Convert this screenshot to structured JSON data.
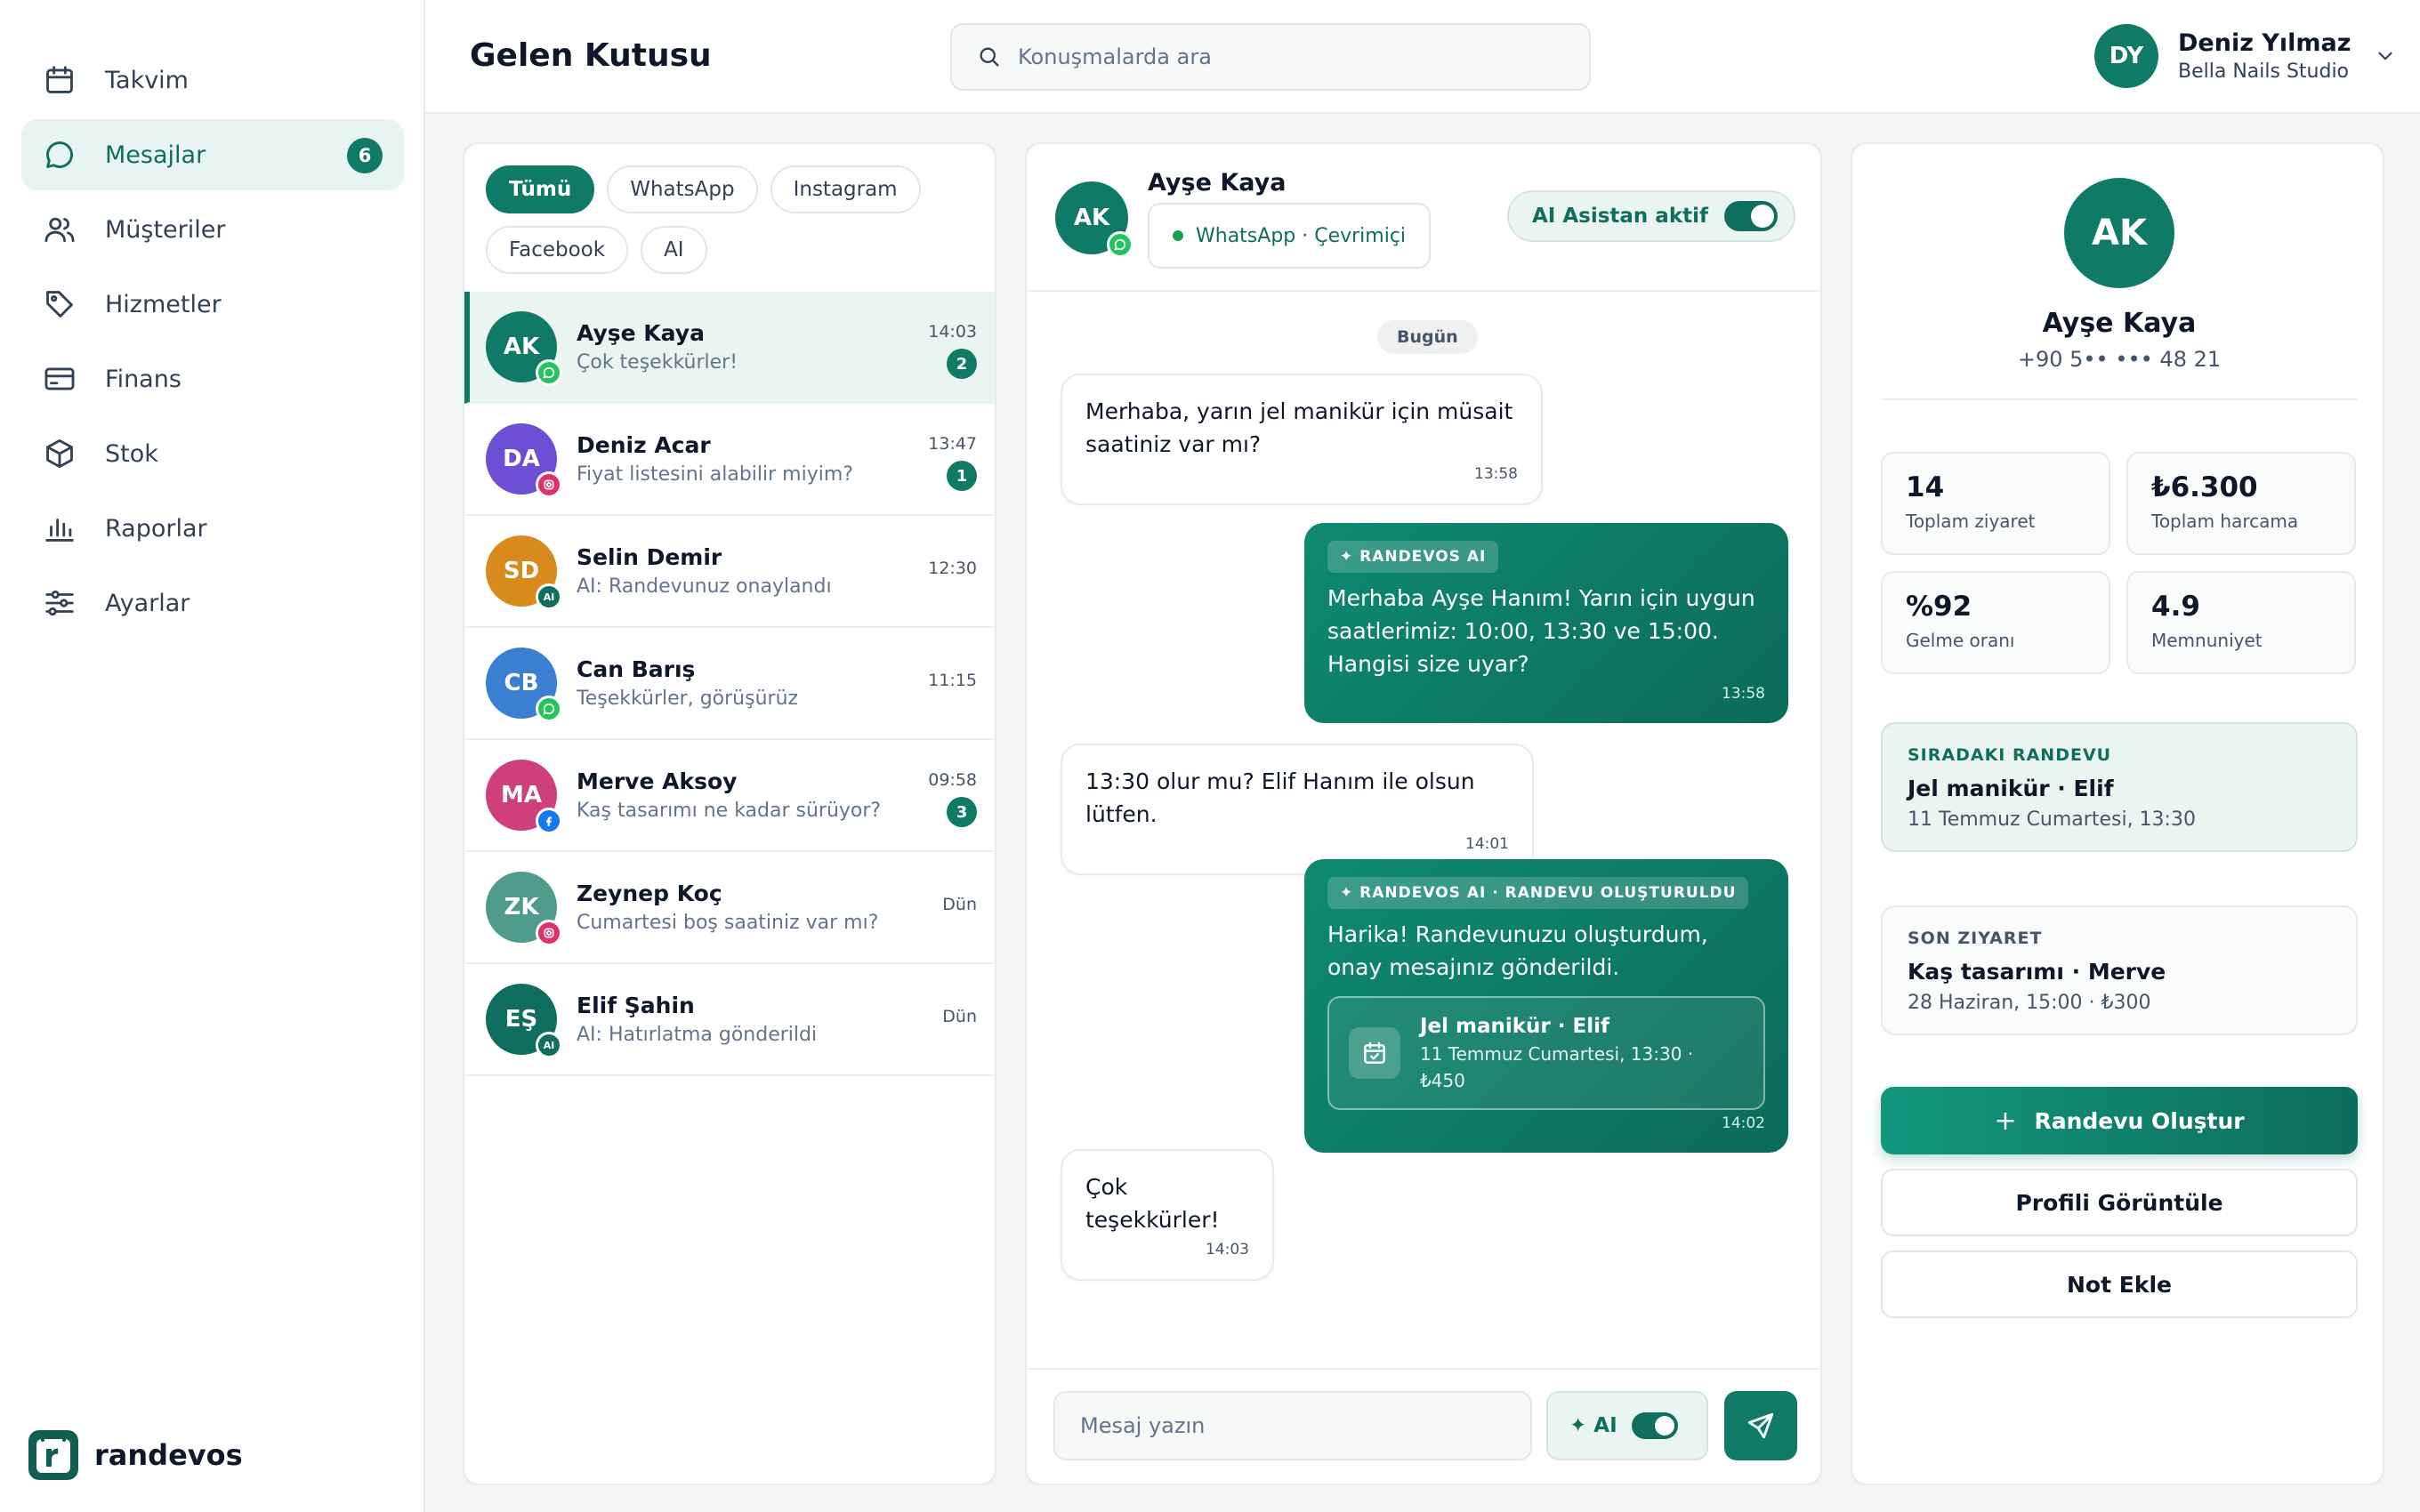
{
  "sidebar": {
    "items": [
      {
        "label": "Takvim",
        "icon": "calendar-icon"
      },
      {
        "label": "Mesajlar",
        "icon": "message-icon",
        "badge": "6",
        "active": true
      },
      {
        "label": "Müşteriler",
        "icon": "users-icon"
      },
      {
        "label": "Hizmetler",
        "icon": "tag-icon"
      },
      {
        "label": "Finans",
        "icon": "credit-card-icon"
      },
      {
        "label": "Stok",
        "icon": "box-icon"
      },
      {
        "label": "Raporlar",
        "icon": "bar-chart-icon"
      },
      {
        "label": "Ayarlar",
        "icon": "sliders-icon"
      }
    ],
    "brand": "randevos"
  },
  "header": {
    "title": "Gelen Kutusu",
    "search_placeholder": "Konuşmalarda ara",
    "user": {
      "initials": "DY",
      "name": "Deniz Yılmaz",
      "studio": "Bella Nails Studio"
    }
  },
  "filters": [
    "Tümü",
    "WhatsApp",
    "Instagram",
    "Facebook",
    "AI"
  ],
  "conversations": [
    {
      "initials": "AK",
      "name": "Ayşe Kaya",
      "preview": "Çok teşekkürler!",
      "time": "14:03",
      "unread": "2",
      "channel": "whatsapp",
      "color": "#0f7a66"
    },
    {
      "initials": "DA",
      "name": "Deniz Acar",
      "preview": "Fiyat listesini alabilir miyim?",
      "time": "13:47",
      "unread": "1",
      "channel": "instagram",
      "color": "#6d4fd6"
    },
    {
      "initials": "SD",
      "name": "Selin Demir",
      "preview": "AI: Randevunuz onaylandı",
      "time": "12:30",
      "unread": "",
      "channel": "ai",
      "color": "#d98a1c"
    },
    {
      "initials": "CB",
      "name": "Can Barış",
      "preview": "Teşekkürler, görüşürüz",
      "time": "11:15",
      "unread": "",
      "channel": "whatsapp",
      "color": "#3b7fd0"
    },
    {
      "initials": "MA",
      "name": "Merve Aksoy",
      "preview": "Kaş tasarımı ne kadar sürüyor?",
      "time": "09:58",
      "unread": "3",
      "channel": "facebook",
      "color": "#cf3f7a"
    },
    {
      "initials": "ZK",
      "name": "Zeynep Koç",
      "preview": "Cumartesi boş saatiniz var mı?",
      "time": "Dün",
      "unread": "",
      "channel": "instagram",
      "color": "#4f9b8c"
    },
    {
      "initials": "EŞ",
      "name": "Elif Şahin",
      "preview": "AI: Hatırlatma gönderildi",
      "time": "Dün",
      "unread": "",
      "channel": "ai",
      "color": "#0f6e5d"
    }
  ],
  "chat": {
    "initials": "AK",
    "name": "Ayşe Kaya",
    "status": "WhatsApp · Çevrimiçi",
    "ai_label": "AI Asistan aktif",
    "day": "Bugün",
    "messages": [
      {
        "text": "Merhaba, yarın jel manikür için müsait saatiniz var mı?",
        "time": "13:58"
      },
      {
        "tag": "✦ RANDEVOS AI",
        "text": "Merhaba Ayşe Hanım! Yarın için uygun saatlerimiz: 10:00, 13:30 ve 15:00. Hangisi size uyar?",
        "time": "13:58"
      },
      {
        "text": "13:30 olur mu? Elif Hanım ile olsun lütfen.",
        "time": "14:01"
      },
      {
        "tag": "✦ RANDEVOS AI · RANDEVU OLUŞTURULDU",
        "text": "Harika! Randevunuzu oluşturdum, onay mesajınız gönderildi.",
        "card_title": "Jel manikür · Elif",
        "card_sub": "11 Temmuz Cumartesi, 13:30 · ₺450",
        "time": "14:02"
      },
      {
        "text": "Çok teşekkürler!",
        "time": "14:03"
      }
    ],
    "composer_placeholder": "Mesaj yazın",
    "ai_mini": "✦ AI"
  },
  "profile": {
    "initials": "AK",
    "name": "Ayşe Kaya",
    "phone": "+90 5•• ••• 48 21",
    "stats": [
      {
        "value": "14",
        "label": "Toplam ziyaret"
      },
      {
        "value": "₺6.300",
        "label": "Toplam harcama"
      },
      {
        "value": "%92",
        "label": "Gelme oranı"
      },
      {
        "value": "4.9",
        "label": "Memnuniyet"
      }
    ],
    "next": {
      "head": "SIRADAKI RANDEVU",
      "title": "Jel manikür · Elif",
      "sub": "11 Temmuz Cumartesi, 13:30"
    },
    "last": {
      "head": "SON ZIYARET",
      "title": "Kaş tasarımı · Merve",
      "sub": "28 Haziran, 15:00 · ₺300"
    },
    "buttons": {
      "create": "Randevu Oluştur",
      "create_icon": "+",
      "view": "Profili Görüntüle",
      "note": "Not Ekle"
    }
  },
  "colors": {
    "accent": "#0f7a66",
    "whatsapp": "#22c55e",
    "instagram": "#e1306c",
    "facebook": "#1877f2",
    "ai": "#0f6e5d"
  }
}
